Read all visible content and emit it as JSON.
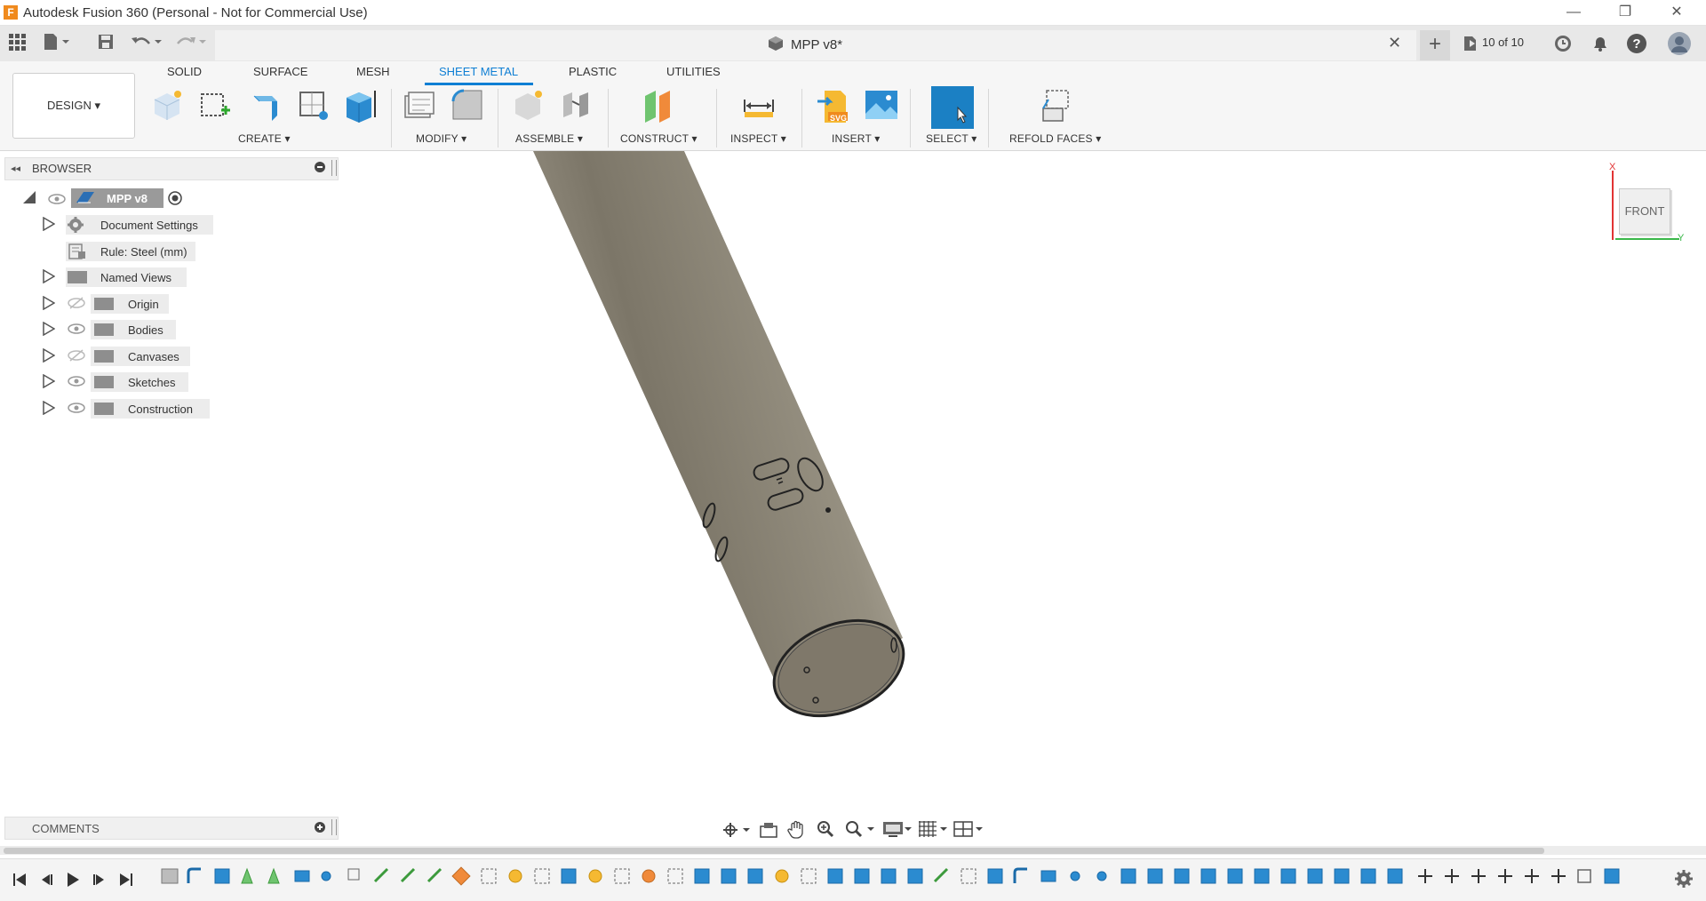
{
  "titlebar": {
    "app_title": "Autodesk Fusion 360 (Personal - Not for Commercial Use)",
    "logo_letter": "F",
    "minimize": "—",
    "restore": "❐",
    "close": "✕"
  },
  "tabbar": {
    "doc_title": "MPP v8*",
    "close": "✕",
    "plus": "+",
    "version": "10 of 10"
  },
  "toolbar": {
    "design_button": "DESIGN ▾",
    "tabs": [
      "SOLID",
      "SURFACE",
      "MESH",
      "SHEET METAL",
      "PLASTIC",
      "UTILITIES"
    ],
    "active_tab": "SHEET METAL",
    "groups": {
      "create": "CREATE ▾",
      "modify": "MODIFY ▾",
      "assemble": "ASSEMBLE ▾",
      "construct": "CONSTRUCT ▾",
      "inspect": "INSPECT ▾",
      "insert": "INSERT ▾",
      "select": "SELECT ▾",
      "refold": "REFOLD FACES ▾"
    },
    "insert_svg_label": "SVG"
  },
  "browser": {
    "title": "BROWSER",
    "root": "MPP v8",
    "items": [
      {
        "label": "Document Settings",
        "icon": "gear-icon"
      },
      {
        "label": "Rule: Steel (mm)",
        "icon": "rule-icon"
      },
      {
        "label": "Named Views",
        "icon": "folder-icon"
      },
      {
        "label": "Origin",
        "icon": "folder-icon"
      },
      {
        "label": "Bodies",
        "icon": "folder-icon"
      },
      {
        "label": "Canvases",
        "icon": "folder-icon"
      },
      {
        "label": "Sketches",
        "icon": "folder-icon"
      },
      {
        "label": "Construction",
        "icon": "folder-icon"
      }
    ]
  },
  "viewcube": {
    "face": "FRONT",
    "x_axis": "X",
    "y_axis": "Y"
  },
  "comments": {
    "title": "COMMENTS"
  },
  "colors": {
    "accent": "#0f7fd4",
    "tube": "#8a8375",
    "select_blue": "#1b80c4"
  }
}
